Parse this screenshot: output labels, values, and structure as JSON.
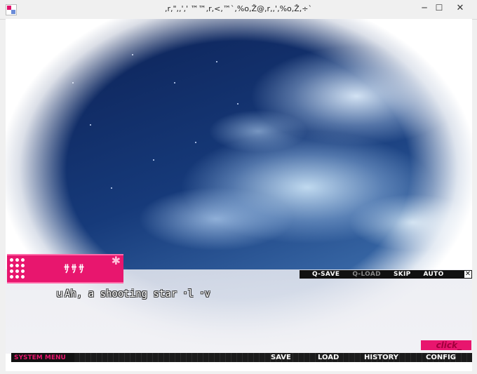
{
  "window": {
    "title": ",r,\",,',' ™™,r,<,™`,%o,Ž@,r,,',%o,Ž,÷`",
    "minimize": "─",
    "maximize": "☐",
    "close": "✕"
  },
  "nameplate": {
    "speaker": "ｻｻｻ"
  },
  "dialogue": {
    "text": "ｕAh, a shooting star ･l ･v"
  },
  "quick_menu": {
    "items": [
      {
        "label": "Q-SAVE",
        "enabled": true
      },
      {
        "label": "Q-LOAD",
        "enabled": false
      },
      {
        "label": "SKIP",
        "enabled": true
      },
      {
        "label": "AUTO",
        "enabled": true
      }
    ],
    "close": "✕"
  },
  "click_indicator": "click_",
  "system_menu": {
    "label": "SYSTEM MENU",
    "save": "SAVE",
    "load": "LOAD",
    "history": "HISTORY",
    "config": "CONFIG"
  },
  "colors": {
    "accent": "#e8166e",
    "bar": "#111111",
    "sky_dark": "#0c1f52"
  }
}
